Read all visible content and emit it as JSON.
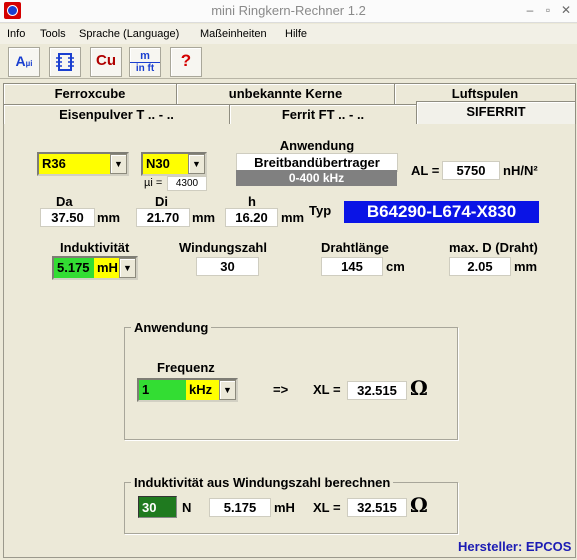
{
  "window": {
    "title": "mini Ringkern-Rechner 1.2",
    "min": "–",
    "max": "▫",
    "close": "✕"
  },
  "menu": [
    "Info",
    "Tools",
    "Sprache (Language)",
    "Maßeinheiten",
    "Hilfe"
  ],
  "toolbar": {
    "btn1": "A",
    "btn1b": "µi",
    "btn3": "Cu",
    "btn4a": "m",
    "btn4b": "in ft",
    "help": "?"
  },
  "tabs": {
    "row1": [
      "Ferroxcube",
      "unbekannte Kerne",
      "Luftspulen"
    ],
    "row2": [
      "Eisenpulver T .. - ..",
      "Ferrit FT .. - ..",
      "SIFERRIT"
    ]
  },
  "core": {
    "size": "R36",
    "material": "N30",
    "mu_label": "µi =",
    "mu_value": "4300",
    "application_label": "Anwendung",
    "application_value": "Breitbandübertrager",
    "freq_range": "0-400 kHz",
    "al_label": "AL =",
    "al_value": "5750",
    "al_unit": "nH/N²"
  },
  "dims": {
    "da_label": "Da",
    "da_value": "37.50",
    "da_unit": "mm",
    "di_label": "Di",
    "di_value": "21.70",
    "di_unit": "mm",
    "h_label": "h",
    "h_value": "16.20",
    "h_unit": "mm",
    "typ_label": "Typ",
    "typ_value": "B64290-L674-X830"
  },
  "calc": {
    "ind_label": "Induktivität",
    "ind_value": "5.175",
    "ind_unit": "mH",
    "turns_label": "Windungszahl",
    "turns_value": "30",
    "wire_label": "Drahtlänge",
    "wire_value": "145",
    "wire_unit": "cm",
    "maxd_label": "max. D (Draht)",
    "maxd_value": "2.05",
    "maxd_unit": "mm"
  },
  "anwendung": {
    "legend": "Anwendung",
    "freq_label": "Frequenz",
    "freq_value": "1",
    "freq_unit": "kHz",
    "arrow": "=>",
    "xl_label": "XL =",
    "xl_value": "32.515",
    "ohm": "Ω"
  },
  "indcalc": {
    "legend": "Induktivität aus Windungszahl berechnen",
    "n_value": "30",
    "n_label": "N",
    "l_value": "5.175",
    "l_unit": "mH",
    "xl_label": "XL =",
    "xl_value": "32.515",
    "ohm": "Ω"
  },
  "footer": {
    "manufacturer": "Hersteller: EPCOS"
  },
  "colors": {
    "highlight_yellow": "#ffff00",
    "green": "#33dd33",
    "dark_green": "#1f7a1f",
    "type_blue": "#0a14e6",
    "footer_blue": "#1c1cb4"
  }
}
